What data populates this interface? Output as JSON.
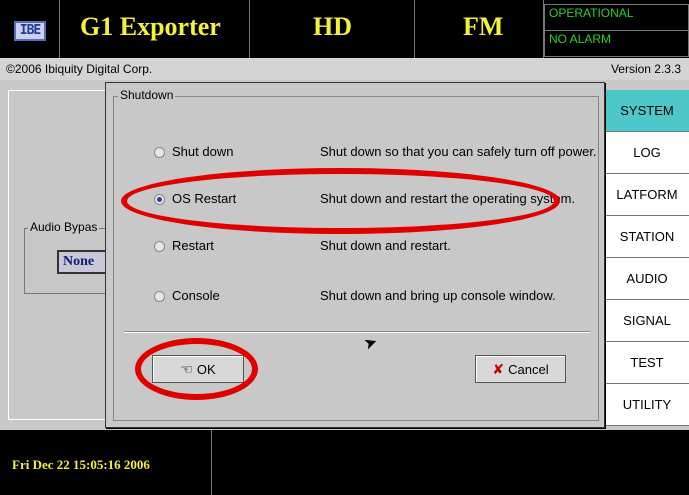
{
  "header": {
    "logo_text": "IBE",
    "app_title": "G1 Exporter",
    "hd_label": "HD",
    "fm_label": "FM",
    "status_operational": "OPERATIONAL",
    "status_alarm": "NO ALARM"
  },
  "copyright": "©2006 Ibiquity Digital Corp.",
  "version": "Version 2.3.3",
  "background_panel": {
    "audio_bypass_label": "Audio Bypas",
    "audio_bypass_value": "None"
  },
  "menu": {
    "items": [
      "SYSTEM",
      "LOG",
      "LATFORM",
      "STATION",
      "AUDIO",
      "SIGNAL",
      "TEST",
      "UTILITY"
    ],
    "active": "SYSTEM",
    "active_color": "#4dc7c7"
  },
  "footer": {
    "datetime": "Fri Dec 22 15:05:16 2006"
  },
  "dialog": {
    "group_label": "Shutdown",
    "options": [
      {
        "label": "Shut down",
        "description": "Shut down so that you can safely turn off power.",
        "selected": false
      },
      {
        "label": "OS Restart",
        "description": "Shut down and restart the operating system.",
        "selected": true
      },
      {
        "label": "Restart",
        "description": "Shut down and restart.",
        "selected": false
      },
      {
        "label": "Console",
        "description": "Shut down and bring up console window.",
        "selected": false
      }
    ],
    "ok_label": "OK",
    "cancel_label": "Cancel"
  },
  "annotation_color": "#e00000"
}
